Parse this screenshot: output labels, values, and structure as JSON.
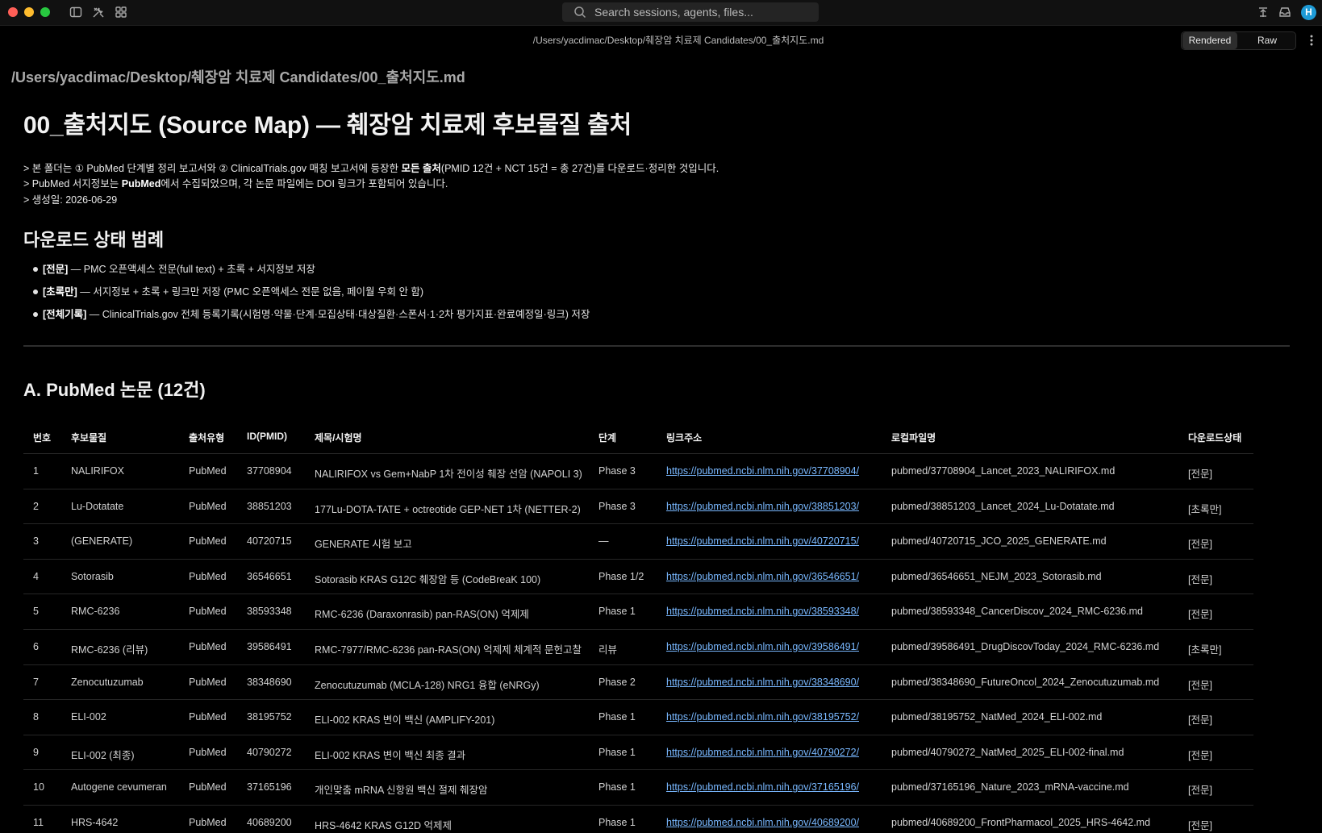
{
  "search": {
    "placeholder": "Search sessions, agents, files..."
  },
  "avatar": {
    "initial": "H"
  },
  "path": "/Users/yacdimac/Desktop/췌장암 치료제 Candidates/00_출처지도.md",
  "view_toggle": {
    "rendered": "Rendered",
    "raw": "Raw"
  },
  "doc": {
    "file_heading": "/Users/yacdimac/Desktop/췌장암 치료제 Candidates/00_출처지도.md",
    "title": "00_출처지도 (Source Map) — 췌장암 치료제 후보물질 출처",
    "quote": [
      {
        "pre": "> 본 폴더는 ① PubMed 단계별 정리 보고서와 ② ClinicalTrials.gov 매칭 보고서에 등장한 ",
        "bold": "모든 출처",
        "post": "(PMID 12건 + NCT 15건 = 총 27건)를 다운로드·정리한 것입니다."
      },
      {
        "pre": "> PubMed 서지정보는 ",
        "bold": "PubMed",
        "post": "에서 수집되었으며, 각 논문 파일에는 DOI 링크가 포함되어 있습니다."
      },
      {
        "pre": "> 생성일: 2026-06-29",
        "bold": "",
        "post": ""
      }
    ],
    "legend_heading": "다운로드 상태 범례",
    "legend": [
      {
        "tag": "[전문]",
        "desc": " — PMC 오픈액세스 전문(full text) + 초록 + 서지정보 저장"
      },
      {
        "tag": "[초록만]",
        "desc": " — 서지정보 + 초록 + 링크만 저장 (PMC 오픈액세스 전문 없음, 페이월 우회 안 함)"
      },
      {
        "tag": "[전체기록]",
        "desc": " — ClinicalTrials.gov 전체 등록기록(시험명·약물·단계·모집상태·대상질환·스폰서·1·2차 평가지표·완료예정일·링크) 저장"
      }
    ],
    "section_a": "A. PubMed 논문 (12건)"
  },
  "table": {
    "headers": [
      "번호",
      "후보물질",
      "출처유형",
      "ID(PMID)",
      "제목/시험명",
      "단계",
      "링크주소",
      "로컬파일명",
      "다운로드상태"
    ],
    "rows": [
      [
        "1",
        "NALIRIFOX",
        "PubMed",
        "37708904",
        "NALIRIFOX vs Gem+NabP 1차 전이성 췌장 선암 (NAPOLI 3)",
        "Phase 3",
        "https://pubmed.ncbi.nlm.nih.gov/37708904/",
        "pubmed/37708904_Lancet_2023_NALIRIFOX.md",
        "[전문]"
      ],
      [
        "2",
        "Lu-Dotatate",
        "PubMed",
        "38851203",
        "177Lu-DOTA-TATE + octreotide GEP-NET 1차 (NETTER-2)",
        "Phase 3",
        "https://pubmed.ncbi.nlm.nih.gov/38851203/",
        "pubmed/38851203_Lancet_2024_Lu-Dotatate.md",
        "[초록만]"
      ],
      [
        "3",
        "(GENERATE)",
        "PubMed",
        "40720715",
        "GENERATE 시험 보고",
        "—",
        "https://pubmed.ncbi.nlm.nih.gov/40720715/",
        "pubmed/40720715_JCO_2025_GENERATE.md",
        "[전문]"
      ],
      [
        "4",
        "Sotorasib",
        "PubMed",
        "36546651",
        "Sotorasib KRAS G12C 췌장암 등 (CodeBreaK 100)",
        "Phase 1/2",
        "https://pubmed.ncbi.nlm.nih.gov/36546651/",
        "pubmed/36546651_NEJM_2023_Sotorasib.md",
        "[전문]"
      ],
      [
        "5",
        "RMC-6236",
        "PubMed",
        "38593348",
        "RMC-6236 (Daraxonrasib) pan-RAS(ON) 억제제",
        "Phase 1",
        "https://pubmed.ncbi.nlm.nih.gov/38593348/",
        "pubmed/38593348_CancerDiscov_2024_RMC-6236.md",
        "[전문]"
      ],
      [
        "6",
        "RMC-6236 (리뷰)",
        "PubMed",
        "39586491",
        "RMC-7977/RMC-6236 pan-RAS(ON) 억제제 체계적 문헌고찰",
        "리뷰",
        "https://pubmed.ncbi.nlm.nih.gov/39586491/",
        "pubmed/39586491_DrugDiscovToday_2024_RMC-6236.md",
        "[초록만]"
      ],
      [
        "7",
        "Zenocutuzumab",
        "PubMed",
        "38348690",
        "Zenocutuzumab (MCLA-128) NRG1 융합 (eNRGy)",
        "Phase 2",
        "https://pubmed.ncbi.nlm.nih.gov/38348690/",
        "pubmed/38348690_FutureOncol_2024_Zenocutuzumab.md",
        "[전문]"
      ],
      [
        "8",
        "ELI-002",
        "PubMed",
        "38195752",
        "ELI-002 KRAS 변이 백신 (AMPLIFY-201)",
        "Phase 1",
        "https://pubmed.ncbi.nlm.nih.gov/38195752/",
        "pubmed/38195752_NatMed_2024_ELI-002.md",
        "[전문]"
      ],
      [
        "9",
        "ELI-002 (최종)",
        "PubMed",
        "40790272",
        "ELI-002 KRAS 변이 백신 최종 결과",
        "Phase 1",
        "https://pubmed.ncbi.nlm.nih.gov/40790272/",
        "pubmed/40790272_NatMed_2025_ELI-002-final.md",
        "[전문]"
      ],
      [
        "10",
        "Autogene cevumeran",
        "PubMed",
        "37165196",
        "개인맞춤 mRNA 신항원 백신 절제 췌장암",
        "Phase 1",
        "https://pubmed.ncbi.nlm.nih.gov/37165196/",
        "pubmed/37165196_Nature_2023_mRNA-vaccine.md",
        "[전문]"
      ],
      [
        "11",
        "HRS-4642",
        "PubMed",
        "40689200",
        "HRS-4642 KRAS G12D 억제제",
        "Phase 1",
        "https://pubmed.ncbi.nlm.nih.gov/40689200/",
        "pubmed/40689200_FrontPharmacol_2025_HRS-4642.md",
        "[전문]"
      ]
    ]
  }
}
